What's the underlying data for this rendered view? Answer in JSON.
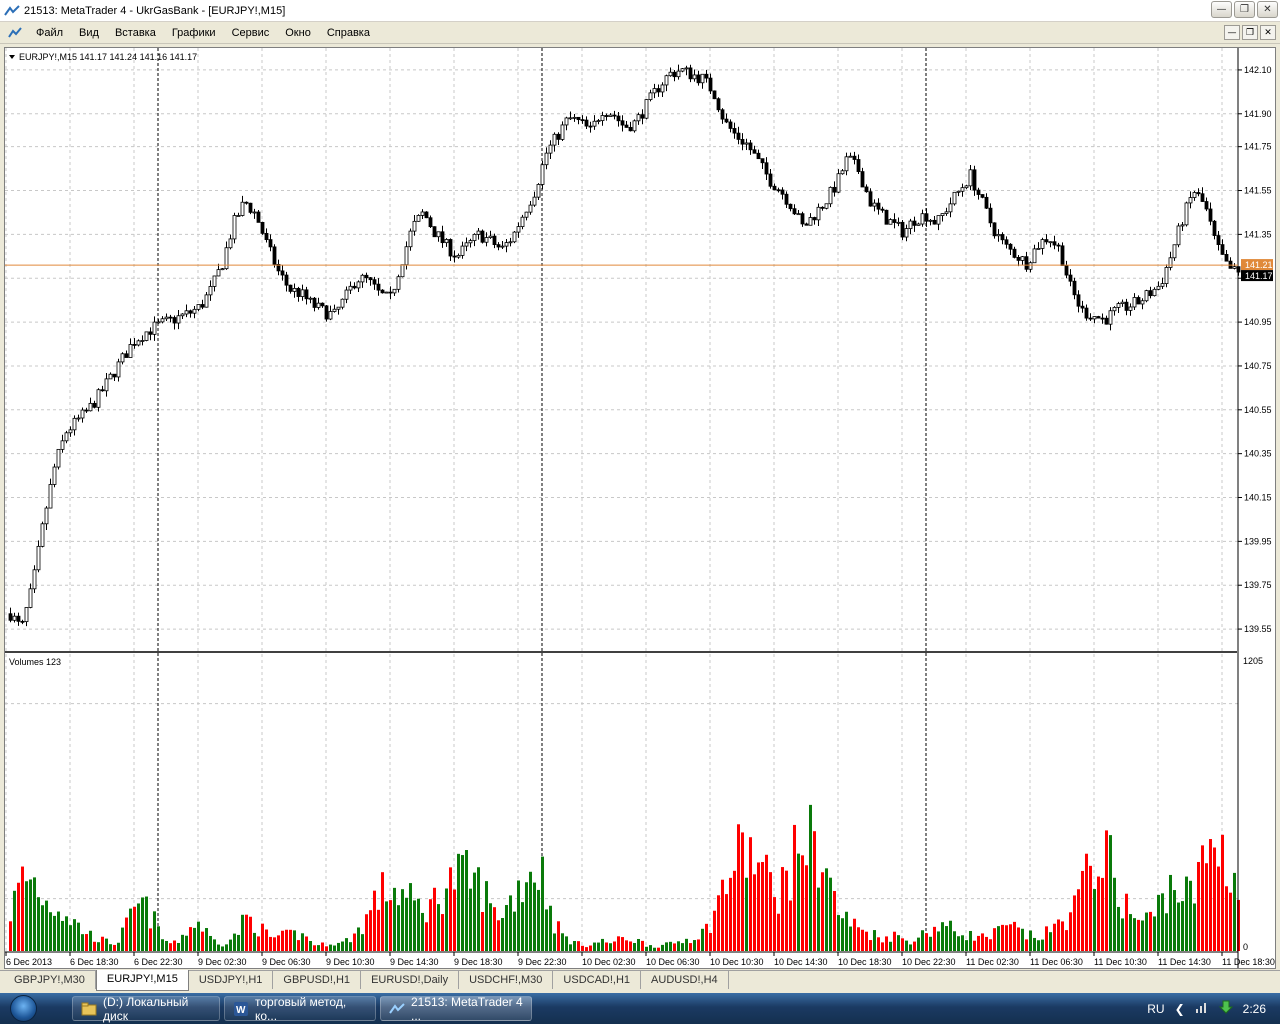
{
  "window": {
    "title": "21513: MetaTrader 4 - UkrGasBank - [EURJPY!,M15]"
  },
  "menu": [
    "Файл",
    "Вид",
    "Вставка",
    "Графики",
    "Сервис",
    "Окно",
    "Справка"
  ],
  "chart": {
    "header": "EURJPY!,M15  141.17 141.24 141.16 141.17",
    "current_price": "141.21",
    "last_price": "141.17",
    "volume_label": "Volumes 123",
    "volume_max_label": "1205",
    "volume_min_label": "0",
    "colors": {
      "bull": "#0a7a0a",
      "bear": "#ff0000",
      "price_line": "#e0893a",
      "grid": "#c8c8c8",
      "candle": "#000000"
    }
  },
  "chart_data": {
    "type": "candlestick",
    "price_axis": {
      "min": 139.45,
      "max": 142.2,
      "ticks": [
        "142.10",
        "141.90",
        "141.75",
        "141.55",
        "141.35",
        "141.15",
        "140.95",
        "140.75",
        "140.55",
        "140.35",
        "140.15",
        "139.95",
        "139.75",
        "139.55"
      ]
    },
    "time_labels": [
      "6 Dec 2013",
      "6 Dec 18:30",
      "6 Dec 22:30",
      "9 Dec 02:30",
      "9 Dec 06:30",
      "9 Dec 10:30",
      "9 Dec 14:30",
      "9 Dec 18:30",
      "9 Dec 22:30",
      "10 Dec 02:30",
      "10 Dec 06:30",
      "10 Dec 10:30",
      "10 Dec 14:30",
      "10 Dec 18:30",
      "10 Dec 22:30",
      "11 Dec 02:30",
      "11 Dec 06:30",
      "11 Dec 10:30",
      "11 Dec 14:30",
      "11 Dec 18:30"
    ],
    "close_path": [
      139.62,
      139.55,
      139.75,
      140.05,
      140.3,
      140.45,
      140.5,
      140.55,
      140.62,
      140.7,
      140.78,
      140.86,
      140.9,
      140.93,
      140.95,
      140.97,
      140.99,
      141.02,
      141.1,
      141.22,
      141.4,
      141.5,
      141.44,
      141.3,
      141.18,
      141.1,
      141.08,
      141.03,
      141.0,
      140.98,
      141.06,
      141.15,
      141.14,
      141.08,
      141.05,
      141.22,
      141.38,
      141.45,
      141.36,
      141.3,
      141.25,
      141.3,
      141.35,
      141.32,
      141.28,
      141.34,
      141.45,
      141.55,
      141.72,
      141.8,
      141.88,
      141.86,
      141.82,
      141.92,
      141.9,
      141.84,
      141.86,
      141.94,
      142.02,
      142.08,
      142.1,
      142.08,
      142.06,
      142.0,
      141.86,
      141.8,
      141.76,
      141.68,
      141.6,
      141.55,
      141.48,
      141.38,
      141.44,
      141.5,
      141.58,
      141.7,
      141.64,
      141.5,
      141.44,
      141.4,
      141.36,
      141.42,
      141.44,
      141.4,
      141.48,
      141.55,
      141.62,
      141.5,
      141.38,
      141.3,
      141.26,
      141.22,
      141.3,
      141.34,
      141.28,
      141.1,
      141.0,
      140.98,
      140.96,
      141.0,
      141.02,
      141.04,
      141.08,
      141.12,
      141.26,
      141.42,
      141.55,
      141.48,
      141.3,
      141.2,
      141.17
    ],
    "volume_path": [
      160,
      300,
      290,
      200,
      190,
      140,
      90,
      60,
      40,
      30,
      120,
      200,
      140,
      40,
      30,
      90,
      120,
      50,
      30,
      60,
      140,
      100,
      55,
      60,
      70,
      60,
      20,
      35,
      30,
      60,
      120,
      220,
      260,
      240,
      200,
      170,
      210,
      280,
      310,
      300,
      260,
      150,
      180,
      260,
      340,
      330,
      120,
      55,
      30,
      25,
      40,
      35,
      55,
      45,
      25,
      20,
      30,
      45,
      60,
      90,
      210,
      330,
      420,
      380,
      300,
      250,
      320,
      470,
      440,
      360,
      170,
      120,
      90,
      70,
      55,
      65,
      40,
      60,
      90,
      110,
      80,
      70,
      55,
      60,
      90,
      95,
      65,
      55,
      80,
      120,
      170,
      280,
      420,
      370,
      230,
      140,
      120,
      160,
      270,
      260,
      220,
      350,
      480,
      380,
      260
    ]
  },
  "tabs": [
    {
      "label": "GBPJPY!,M30",
      "active": false
    },
    {
      "label": "EURJPY!,M15",
      "active": true
    },
    {
      "label": "USDJPY!,H1",
      "active": false
    },
    {
      "label": "GBPUSD!,H1",
      "active": false
    },
    {
      "label": "EURUSD!,Daily",
      "active": false
    },
    {
      "label": "USDCHF!,M30",
      "active": false
    },
    {
      "label": "USDCAD!,H1",
      "active": false
    },
    {
      "label": "AUDUSD!,H4",
      "active": false
    }
  ],
  "taskbar": {
    "tasks": [
      {
        "label": "(D:) Локальный диск",
        "icon": "folder-icon"
      },
      {
        "label": "торговый метод, ко...",
        "icon": "word-icon"
      },
      {
        "label": "21513: MetaTrader 4 ...",
        "icon": "metatrader-icon"
      }
    ],
    "language": "RU",
    "clock": "2:26"
  }
}
